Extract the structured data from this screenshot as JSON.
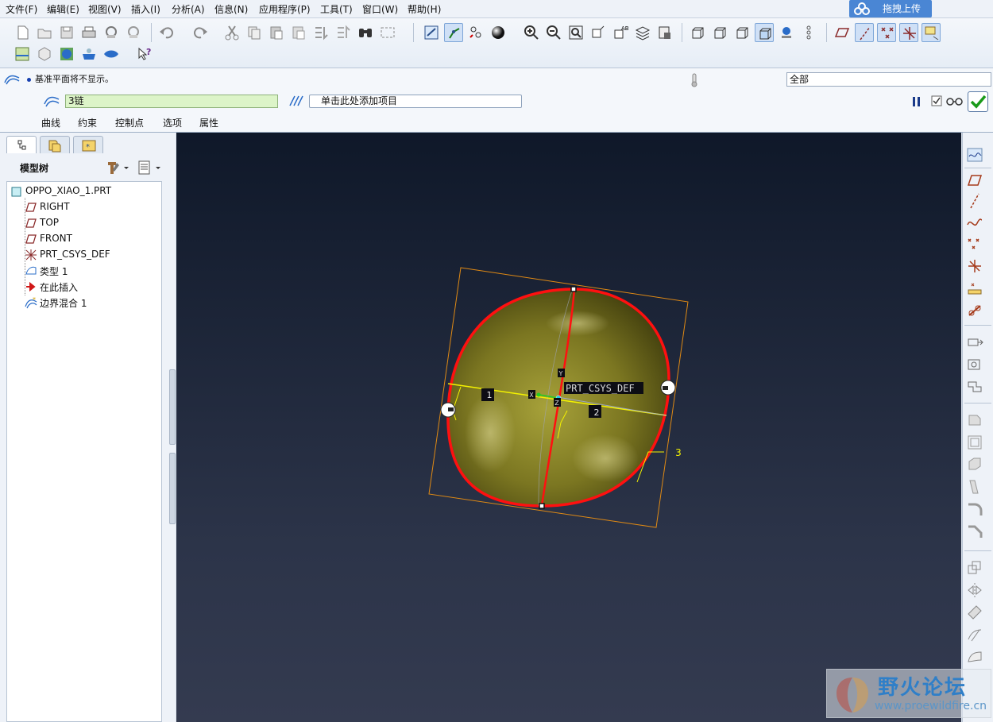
{
  "menu": {
    "items": [
      "文件(F)",
      "编辑(E)",
      "视图(V)",
      "插入(I)",
      "分析(A)",
      "信息(N)",
      "应用程序(P)",
      "工具(T)",
      "窗口(W)",
      "帮助(H)"
    ],
    "upload_label": "拖拽上传"
  },
  "toolbar": {
    "icons": [
      "new-icon",
      "open-icon",
      "save-icon",
      "print-icon",
      "send-icon",
      "send2-icon",
      "undo-icon",
      "redo-icon",
      "cut-icon",
      "copy-icon",
      "paste-icon",
      "paste-special-icon",
      "regenerate-icon",
      "regenerate2-icon",
      "find-icon",
      "select-box-icon",
      "repaint-icon",
      "spin-center-icon",
      "orient-icon",
      "shade-icon",
      "zoom-in-icon",
      "zoom-out-icon",
      "refit-icon",
      "orient-view-icon",
      "named-views-icon",
      "layers-icon",
      "appearance-icon",
      "wireframe-icon",
      "hidden-line-icon",
      "no-hidden-icon",
      "shading-icon",
      "enhanced-realism-icon",
      "spin-icon",
      "datum-plane-display-icon",
      "datum-axis-display-icon",
      "point-display-icon",
      "csys-display-icon",
      "annotation-display-icon"
    ],
    "row2_icons": [
      "model-display-icon",
      "sketch-icon",
      "globe-icon",
      "pot-icon",
      "lips-icon",
      "whats-this-icon"
    ]
  },
  "dashboard": {
    "message": "基准平面将不显示。",
    "filter_value": "全部",
    "first_direction_value": "3链",
    "second_direction_placeholder": "单击此处添加项目",
    "tabs": [
      "曲线",
      "约束",
      "控制点",
      "选项",
      "属性"
    ]
  },
  "left_panel": {
    "header": "模型树",
    "tree": [
      {
        "label": "OPPO_XIAO_1.PRT",
        "icon": "part-icon"
      },
      {
        "label": "RIGHT",
        "icon": "datum-plane-icon"
      },
      {
        "label": "TOP",
        "icon": "datum-plane-icon"
      },
      {
        "label": "FRONT",
        "icon": "datum-plane-icon"
      },
      {
        "label": "PRT_CSYS_DEF",
        "icon": "csys-icon"
      },
      {
        "label": "类型 1",
        "icon": "sketch-feature-icon"
      },
      {
        "label": "在此插入",
        "icon": "insert-here-icon"
      },
      {
        "label": "边界混合 1",
        "icon": "boundary-blend-icon"
      }
    ]
  },
  "viewport": {
    "csys_label": "PRT_CSYS_DEF",
    "curve_labels": [
      "1",
      "2",
      "3"
    ],
    "axis_labels": [
      "Y",
      "X",
      "Z"
    ]
  },
  "watermark": {
    "title": "野火论坛",
    "url": "www.proewildfire.cn"
  },
  "colors": {
    "surface": "#7b7621",
    "curve_red": "#ff1010",
    "chain_yellow": "#f4f200",
    "box_orange": "#e08a14",
    "viewport_top": "#0f1829",
    "viewport_bottom": "#343b50"
  }
}
